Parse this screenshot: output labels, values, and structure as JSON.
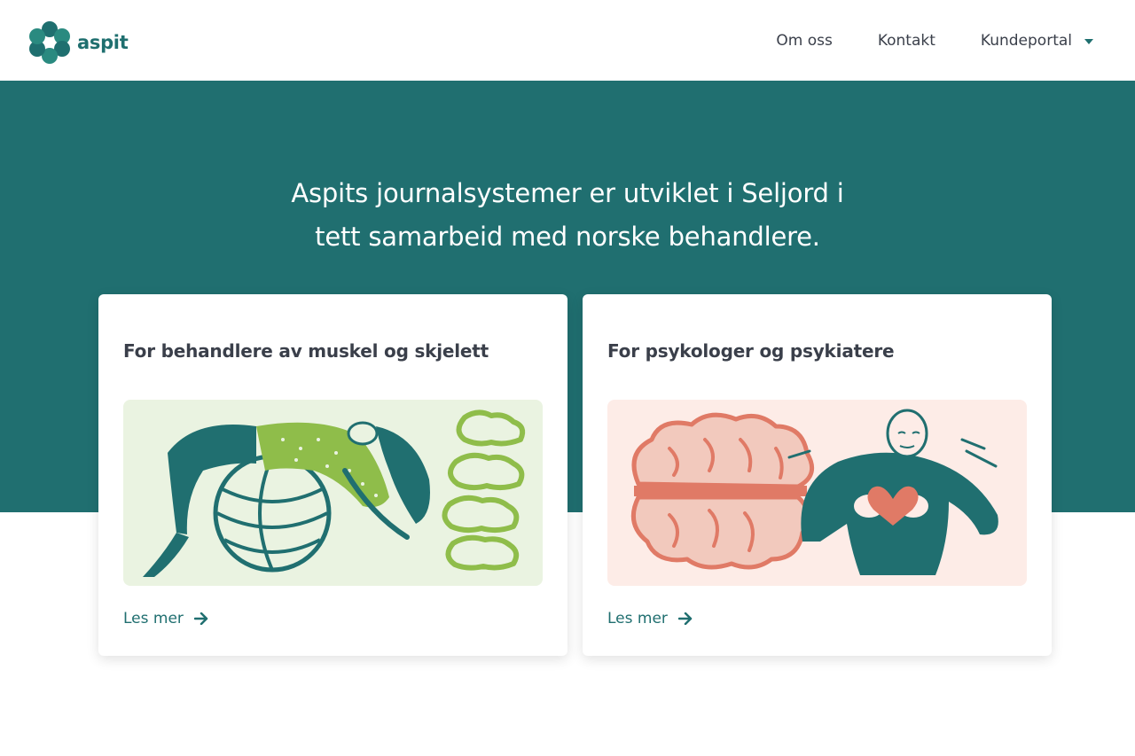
{
  "header": {
    "brand": "aspit",
    "nav": [
      {
        "label": "Om oss"
      },
      {
        "label": "Kontakt"
      },
      {
        "label": "Kundeportal",
        "icon": "caret-down-icon"
      }
    ]
  },
  "hero": {
    "title_line1": "Aspits journalsystemer er utviklet i Seljord i",
    "title_line2": "tett samarbeid med norske behandlere."
  },
  "cards": [
    {
      "title": "For behandlere av muskel og skjelett",
      "link_label": "Les mer",
      "icon": "arrow-right-icon",
      "illustration": "woman-on-exercise-ball-with-spine"
    },
    {
      "title": "For psykologer og psykiatere",
      "link_label": "Les mer",
      "icon": "arrow-right-icon",
      "illustration": "brain-and-person-holding-heart"
    }
  ],
  "colors": {
    "brand_teal": "#206f70",
    "link": "#206f70",
    "green_bg": "#eaf3e1",
    "pink_bg": "#fdece7",
    "coral": "#e07a66",
    "lime": "#8fbd4a"
  }
}
